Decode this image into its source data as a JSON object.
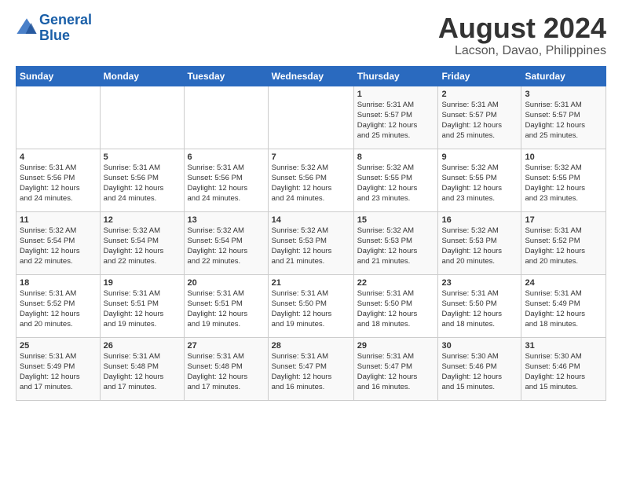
{
  "header": {
    "logo_line1": "General",
    "logo_line2": "Blue",
    "main_title": "August 2024",
    "subtitle": "Lacson, Davao, Philippines"
  },
  "weekdays": [
    "Sunday",
    "Monday",
    "Tuesday",
    "Wednesday",
    "Thursday",
    "Friday",
    "Saturday"
  ],
  "weeks": [
    [
      {
        "day": "",
        "text": ""
      },
      {
        "day": "",
        "text": ""
      },
      {
        "day": "",
        "text": ""
      },
      {
        "day": "",
        "text": ""
      },
      {
        "day": "1",
        "text": "Sunrise: 5:31 AM\nSunset: 5:57 PM\nDaylight: 12 hours\nand 25 minutes."
      },
      {
        "day": "2",
        "text": "Sunrise: 5:31 AM\nSunset: 5:57 PM\nDaylight: 12 hours\nand 25 minutes."
      },
      {
        "day": "3",
        "text": "Sunrise: 5:31 AM\nSunset: 5:57 PM\nDaylight: 12 hours\nand 25 minutes."
      }
    ],
    [
      {
        "day": "4",
        "text": "Sunrise: 5:31 AM\nSunset: 5:56 PM\nDaylight: 12 hours\nand 24 minutes."
      },
      {
        "day": "5",
        "text": "Sunrise: 5:31 AM\nSunset: 5:56 PM\nDaylight: 12 hours\nand 24 minutes."
      },
      {
        "day": "6",
        "text": "Sunrise: 5:31 AM\nSunset: 5:56 PM\nDaylight: 12 hours\nand 24 minutes."
      },
      {
        "day": "7",
        "text": "Sunrise: 5:32 AM\nSunset: 5:56 PM\nDaylight: 12 hours\nand 24 minutes."
      },
      {
        "day": "8",
        "text": "Sunrise: 5:32 AM\nSunset: 5:55 PM\nDaylight: 12 hours\nand 23 minutes."
      },
      {
        "day": "9",
        "text": "Sunrise: 5:32 AM\nSunset: 5:55 PM\nDaylight: 12 hours\nand 23 minutes."
      },
      {
        "day": "10",
        "text": "Sunrise: 5:32 AM\nSunset: 5:55 PM\nDaylight: 12 hours\nand 23 minutes."
      }
    ],
    [
      {
        "day": "11",
        "text": "Sunrise: 5:32 AM\nSunset: 5:54 PM\nDaylight: 12 hours\nand 22 minutes."
      },
      {
        "day": "12",
        "text": "Sunrise: 5:32 AM\nSunset: 5:54 PM\nDaylight: 12 hours\nand 22 minutes."
      },
      {
        "day": "13",
        "text": "Sunrise: 5:32 AM\nSunset: 5:54 PM\nDaylight: 12 hours\nand 22 minutes."
      },
      {
        "day": "14",
        "text": "Sunrise: 5:32 AM\nSunset: 5:53 PM\nDaylight: 12 hours\nand 21 minutes."
      },
      {
        "day": "15",
        "text": "Sunrise: 5:32 AM\nSunset: 5:53 PM\nDaylight: 12 hours\nand 21 minutes."
      },
      {
        "day": "16",
        "text": "Sunrise: 5:32 AM\nSunset: 5:53 PM\nDaylight: 12 hours\nand 20 minutes."
      },
      {
        "day": "17",
        "text": "Sunrise: 5:31 AM\nSunset: 5:52 PM\nDaylight: 12 hours\nand 20 minutes."
      }
    ],
    [
      {
        "day": "18",
        "text": "Sunrise: 5:31 AM\nSunset: 5:52 PM\nDaylight: 12 hours\nand 20 minutes."
      },
      {
        "day": "19",
        "text": "Sunrise: 5:31 AM\nSunset: 5:51 PM\nDaylight: 12 hours\nand 19 minutes."
      },
      {
        "day": "20",
        "text": "Sunrise: 5:31 AM\nSunset: 5:51 PM\nDaylight: 12 hours\nand 19 minutes."
      },
      {
        "day": "21",
        "text": "Sunrise: 5:31 AM\nSunset: 5:50 PM\nDaylight: 12 hours\nand 19 minutes."
      },
      {
        "day": "22",
        "text": "Sunrise: 5:31 AM\nSunset: 5:50 PM\nDaylight: 12 hours\nand 18 minutes."
      },
      {
        "day": "23",
        "text": "Sunrise: 5:31 AM\nSunset: 5:50 PM\nDaylight: 12 hours\nand 18 minutes."
      },
      {
        "day": "24",
        "text": "Sunrise: 5:31 AM\nSunset: 5:49 PM\nDaylight: 12 hours\nand 18 minutes."
      }
    ],
    [
      {
        "day": "25",
        "text": "Sunrise: 5:31 AM\nSunset: 5:49 PM\nDaylight: 12 hours\nand 17 minutes."
      },
      {
        "day": "26",
        "text": "Sunrise: 5:31 AM\nSunset: 5:48 PM\nDaylight: 12 hours\nand 17 minutes."
      },
      {
        "day": "27",
        "text": "Sunrise: 5:31 AM\nSunset: 5:48 PM\nDaylight: 12 hours\nand 17 minutes."
      },
      {
        "day": "28",
        "text": "Sunrise: 5:31 AM\nSunset: 5:47 PM\nDaylight: 12 hours\nand 16 minutes."
      },
      {
        "day": "29",
        "text": "Sunrise: 5:31 AM\nSunset: 5:47 PM\nDaylight: 12 hours\nand 16 minutes."
      },
      {
        "day": "30",
        "text": "Sunrise: 5:30 AM\nSunset: 5:46 PM\nDaylight: 12 hours\nand 15 minutes."
      },
      {
        "day": "31",
        "text": "Sunrise: 5:30 AM\nSunset: 5:46 PM\nDaylight: 12 hours\nand 15 minutes."
      }
    ]
  ]
}
